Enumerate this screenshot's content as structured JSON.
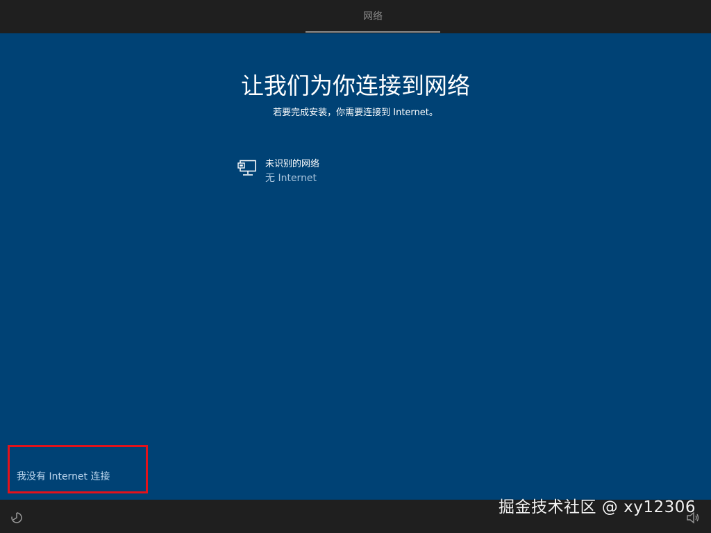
{
  "header": {
    "tab_label": "网络"
  },
  "main": {
    "title": "让我们为你连接到网络",
    "subtitle": "若要完成安装，你需要连接到 Internet。",
    "network": {
      "name": "未识别的网络",
      "status": "无 Internet",
      "icon": "wired-network-icon"
    },
    "no_internet_link": "我没有 Internet 连接"
  },
  "footer": {
    "ease_of_access_icon": "ease-of-access-icon",
    "volume_icon": "volume-icon"
  },
  "watermark": {
    "text": "掘金技术社区 @ xy12306"
  },
  "colors": {
    "background": "#004275",
    "bars": "#1f1f1f",
    "highlight": "#e3121b"
  }
}
